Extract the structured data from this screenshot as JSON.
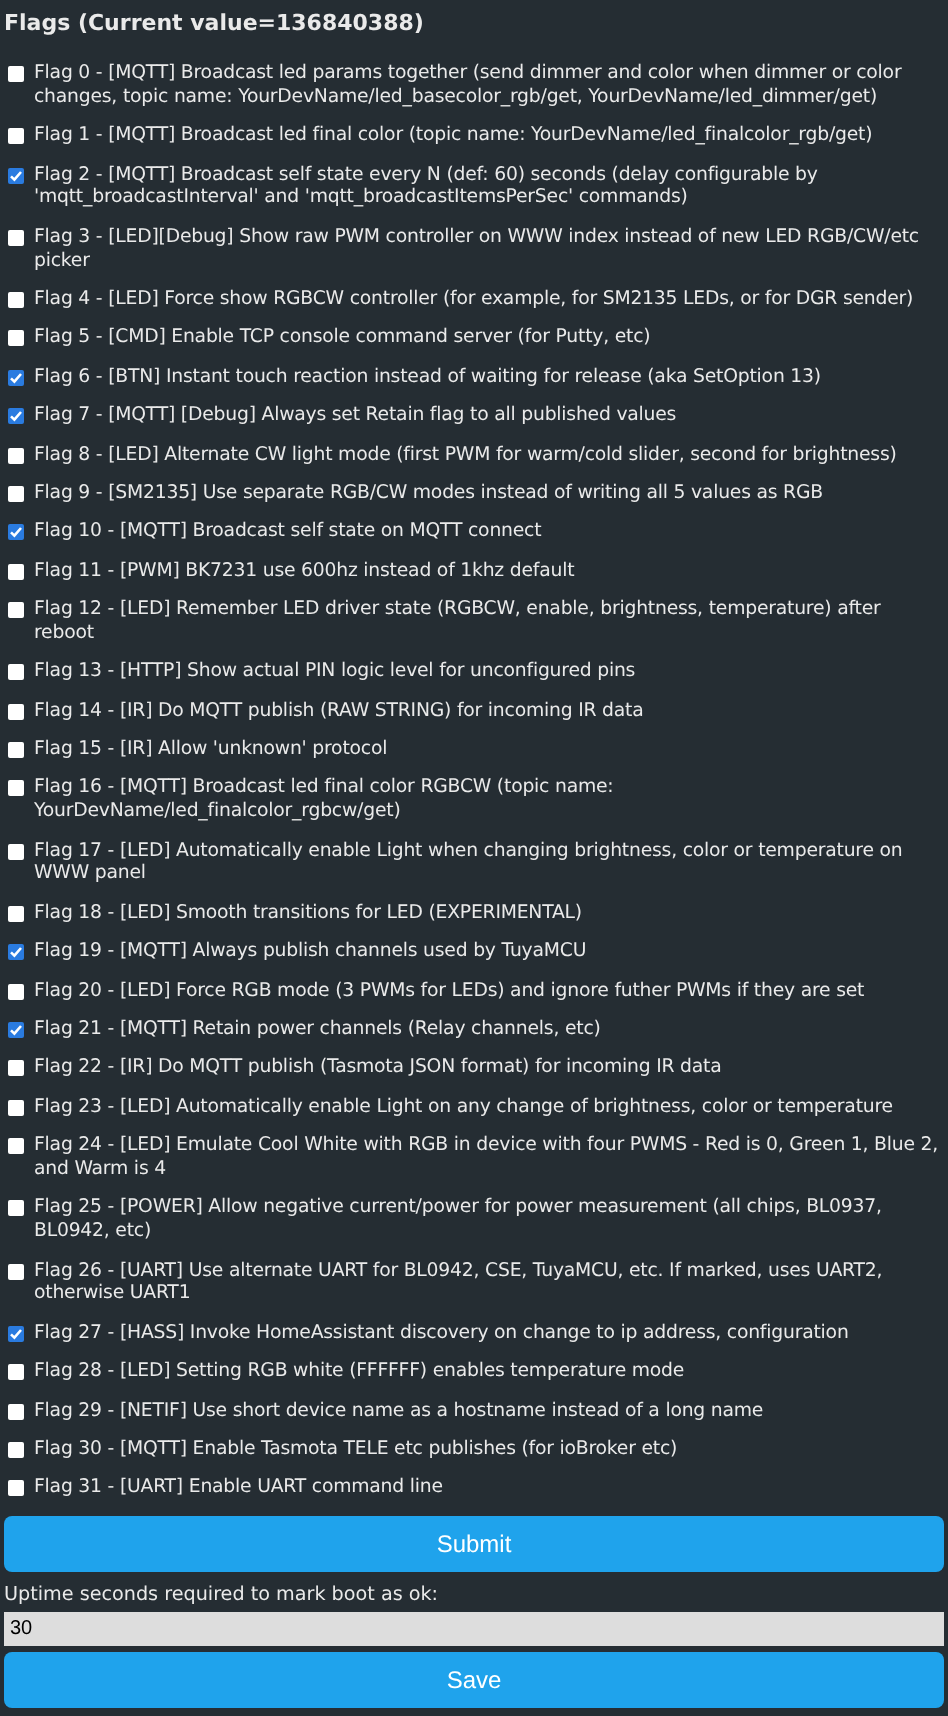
{
  "heading": "Flags (Current value=136840388)",
  "flags": [
    {
      "label": "Flag 0 - [MQTT] Broadcast led params together (send dimmer and color when dimmer or color changes, topic name: YourDevName/led_basecolor_rgb/get, YourDevName/led_dimmer/get)",
      "checked": false
    },
    {
      "label": "Flag 1 - [MQTT] Broadcast led final color (topic name: YourDevName/led_finalcolor_rgb/get)",
      "checked": false
    },
    {
      "label": "Flag 2 - [MQTT] Broadcast self state every N (def: 60) seconds (delay configurable by 'mqtt_broadcastInterval' and 'mqtt_broadcastItemsPerSec' commands)",
      "checked": true
    },
    {
      "label": "Flag 3 - [LED][Debug] Show raw PWM controller on WWW index instead of new LED RGB/CW/etc picker",
      "checked": false
    },
    {
      "label": "Flag 4 - [LED] Force show RGBCW controller (for example, for SM2135 LEDs, or for DGR sender)",
      "checked": false
    },
    {
      "label": "Flag 5 - [CMD] Enable TCP console command server (for Putty, etc)",
      "checked": false
    },
    {
      "label": "Flag 6 - [BTN] Instant touch reaction instead of waiting for release (aka SetOption 13)",
      "checked": true
    },
    {
      "label": "Flag 7 - [MQTT] [Debug] Always set Retain flag to all published values",
      "checked": true
    },
    {
      "label": "Flag 8 - [LED] Alternate CW light mode (first PWM for warm/cold slider, second for brightness)",
      "checked": false
    },
    {
      "label": "Flag 9 - [SM2135] Use separate RGB/CW modes instead of writing all 5 values as RGB",
      "checked": false
    },
    {
      "label": "Flag 10 - [MQTT] Broadcast self state on MQTT connect",
      "checked": true
    },
    {
      "label": "Flag 11 - [PWM] BK7231 use 600hz instead of 1khz default",
      "checked": false
    },
    {
      "label": "Flag 12 - [LED] Remember LED driver state (RGBCW, enable, brightness, temperature) after reboot",
      "checked": false
    },
    {
      "label": "Flag 13 - [HTTP] Show actual PIN logic level for unconfigured pins",
      "checked": false
    },
    {
      "label": "Flag 14 - [IR] Do MQTT publish (RAW STRING) for incoming IR data",
      "checked": false
    },
    {
      "label": "Flag 15 - [IR] Allow 'unknown' protocol",
      "checked": false
    },
    {
      "label": "Flag 16 - [MQTT] Broadcast led final color RGBCW (topic name: YourDevName/led_finalcolor_rgbcw/get)",
      "checked": false
    },
    {
      "label": "Flag 17 - [LED] Automatically enable Light when changing brightness, color or temperature on WWW panel",
      "checked": false
    },
    {
      "label": "Flag 18 - [LED] Smooth transitions for LED (EXPERIMENTAL)",
      "checked": false
    },
    {
      "label": "Flag 19 - [MQTT] Always publish channels used by TuyaMCU",
      "checked": true
    },
    {
      "label": "Flag 20 - [LED] Force RGB mode (3 PWMs for LEDs) and ignore futher PWMs if they are set",
      "checked": false
    },
    {
      "label": "Flag 21 - [MQTT] Retain power channels (Relay channels, etc)",
      "checked": true
    },
    {
      "label": "Flag 22 - [IR] Do MQTT publish (Tasmota JSON format) for incoming IR data",
      "checked": false
    },
    {
      "label": "Flag 23 - [LED] Automatically enable Light on any change of brightness, color or temperature",
      "checked": false
    },
    {
      "label": "Flag 24 - [LED] Emulate Cool White with RGB in device with four PWMS - Red is 0, Green 1, Blue 2, and Warm is 4",
      "checked": false
    },
    {
      "label": "Flag 25 - [POWER] Allow negative current/power for power measurement (all chips, BL0937, BL0942, etc)",
      "checked": false
    },
    {
      "label": "Flag 26 - [UART] Use alternate UART for BL0942, CSE, TuyaMCU, etc. If marked, uses UART2, otherwise UART1",
      "checked": false
    },
    {
      "label": "Flag 27 - [HASS] Invoke HomeAssistant discovery on change to ip address, configuration",
      "checked": true
    },
    {
      "label": "Flag 28 - [LED] Setting RGB white (FFFFFF) enables temperature mode",
      "checked": false
    },
    {
      "label": "Flag 29 - [NETIF] Use short device name as a hostname instead of a long name",
      "checked": false
    },
    {
      "label": "Flag 30 - [MQTT] Enable Tasmota TELE etc publishes (for ioBroker etc)",
      "checked": false
    },
    {
      "label": "Flag 31 - [UART] Enable UART command line",
      "checked": false
    }
  ],
  "submit_button": "Submit",
  "uptime": {
    "label": "Uptime seconds required to mark boot as ok:",
    "value": "30"
  },
  "save_button": "Save"
}
